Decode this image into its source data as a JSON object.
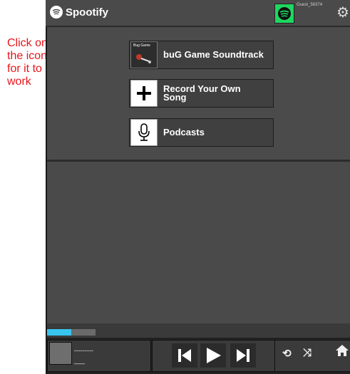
{
  "annotation": {
    "text": "Click on the icon for it to work",
    "color": "#e8141b"
  },
  "header": {
    "app_name": "Spootify",
    "username": "Guest_56374",
    "settings_icon": "gear-icon",
    "brand_color": "#1ed760"
  },
  "menu": {
    "items": [
      {
        "label": "buG Game Soundtrack",
        "icon": "album-art-icon",
        "art_caption": "Bug Game"
      },
      {
        "label": "Record Your Own Song",
        "icon": "plus-icon"
      },
      {
        "label": "Podcasts",
        "icon": "microphone-icon"
      }
    ]
  },
  "player": {
    "progress": 0.5,
    "track_title": "---------",
    "track_artist": "___",
    "controls": [
      "previous-icon",
      "play-icon",
      "next-icon"
    ],
    "extra": [
      "repeat-icon",
      "shuffle-icon",
      "home-icon"
    ],
    "accent_color": "#38c4ee"
  }
}
